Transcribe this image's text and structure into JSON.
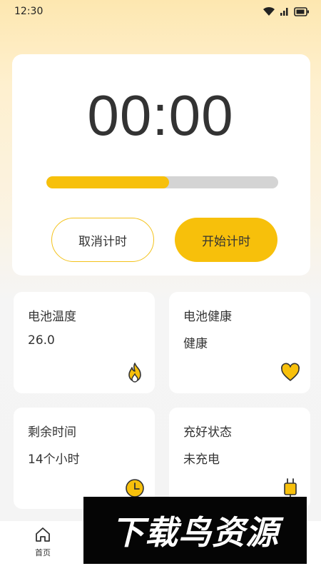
{
  "status_bar": {
    "time": "12:30"
  },
  "timer": {
    "display": "00:00",
    "progress_percent": 53,
    "cancel_label": "取消计时",
    "start_label": "开始计时"
  },
  "cards": [
    {
      "title": "电池温度",
      "value": "26.0",
      "icon": "flame-icon"
    },
    {
      "title": "电池健康",
      "value": "健康",
      "icon": "heart-icon"
    },
    {
      "title": "剩余时间",
      "value": "14个小时",
      "icon": "clock-icon"
    },
    {
      "title": "充好状态",
      "value": "未充电",
      "icon": "plug-icon"
    }
  ],
  "nav": {
    "home_label": "首页"
  },
  "watermark": {
    "text": "下载鸟资源"
  },
  "colors": {
    "accent": "#f7c00b",
    "track": "#d4d4d4",
    "card_bg": "#ffffff"
  }
}
